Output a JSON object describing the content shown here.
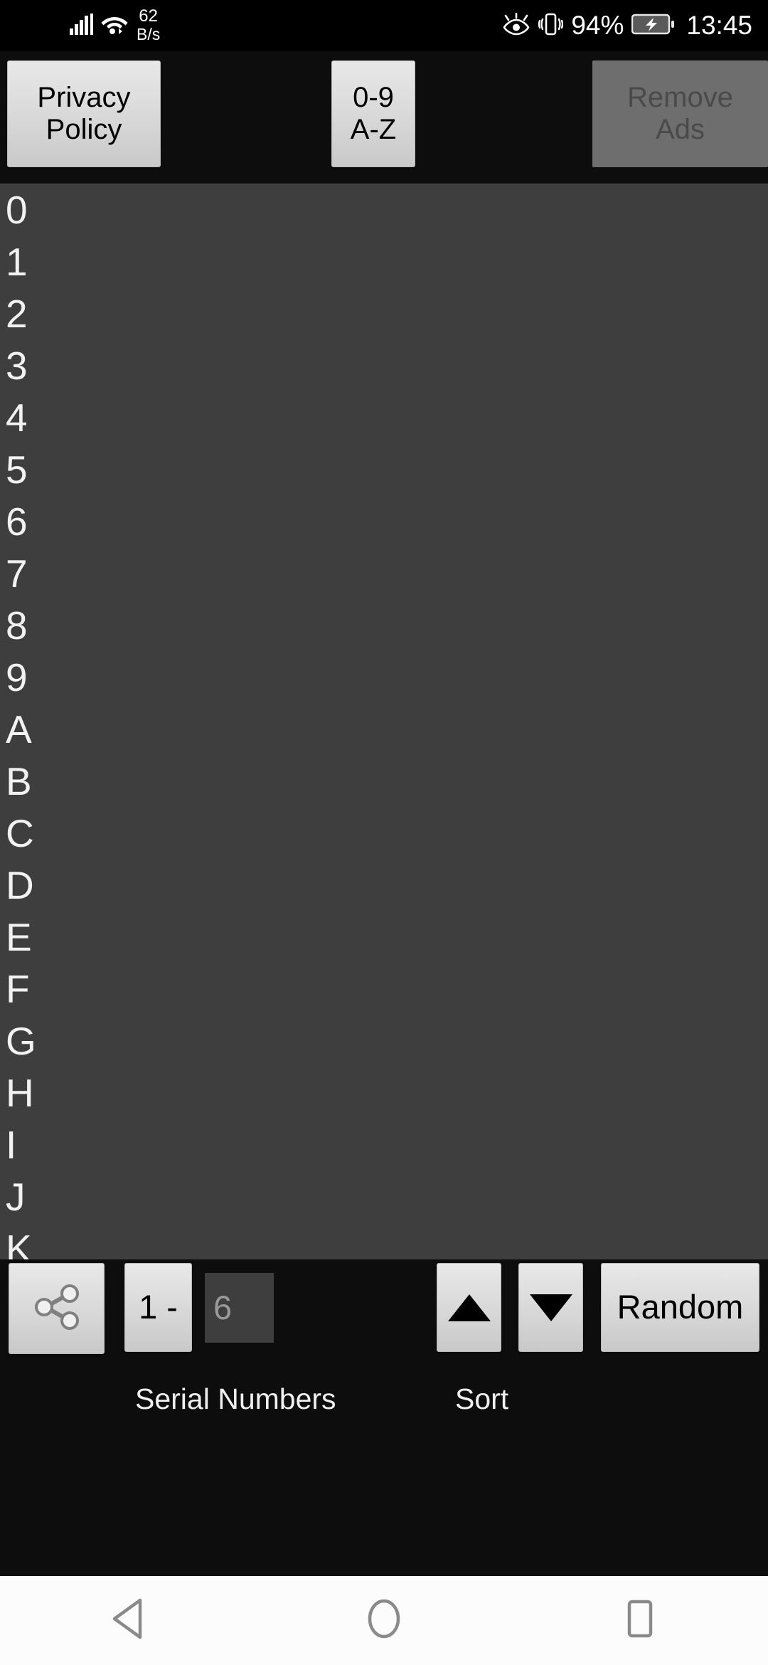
{
  "statusbar": {
    "signal_icon": "cellular-signal-icon",
    "wifi_icon": "wifi-icon",
    "network_speed_value": "62",
    "network_speed_unit": "B/s",
    "eye_comfort_icon": "eye-comfort-icon",
    "vibrate_icon": "vibrate-icon",
    "battery_percent": "94%",
    "battery_icon": "battery-charging-icon",
    "clock": "13:45"
  },
  "topbar": {
    "privacy_policy_label": "Privacy\nPolicy",
    "privacy_policy_line1": "Privacy",
    "privacy_policy_line2": "Policy",
    "sort_mode_line1": "0-9",
    "sort_mode_line2": "A-Z",
    "remove_ads_line1": "Remove",
    "remove_ads_line2": "Ads"
  },
  "list": {
    "items": [
      "0",
      "1",
      "2",
      "3",
      "4",
      "5",
      "6",
      "7",
      "8",
      "9",
      "A",
      "B",
      "C",
      "D",
      "E",
      "F",
      "G",
      "H",
      "I",
      "J",
      "K"
    ]
  },
  "bottombar": {
    "share_icon": "share-icon",
    "range_label": "1 -",
    "count_value": "6",
    "sort_up_icon": "triangle-up-icon",
    "sort_down_icon": "triangle-down-icon",
    "random_label": "Random",
    "serial_numbers_label": "Serial Numbers",
    "sort_label": "Sort"
  },
  "navbar": {
    "back_icon": "back-triangle-icon",
    "home_icon": "home-circle-icon",
    "recents_icon": "recents-square-icon"
  },
  "colors": {
    "app_background": "#0d0d0d",
    "list_background": "#3e3e3e",
    "button_light": "#dcdcdc",
    "button_disabled": "#6e6e6e",
    "text_light": "#f2f2f2",
    "navbar_background": "#fcfcfd"
  }
}
